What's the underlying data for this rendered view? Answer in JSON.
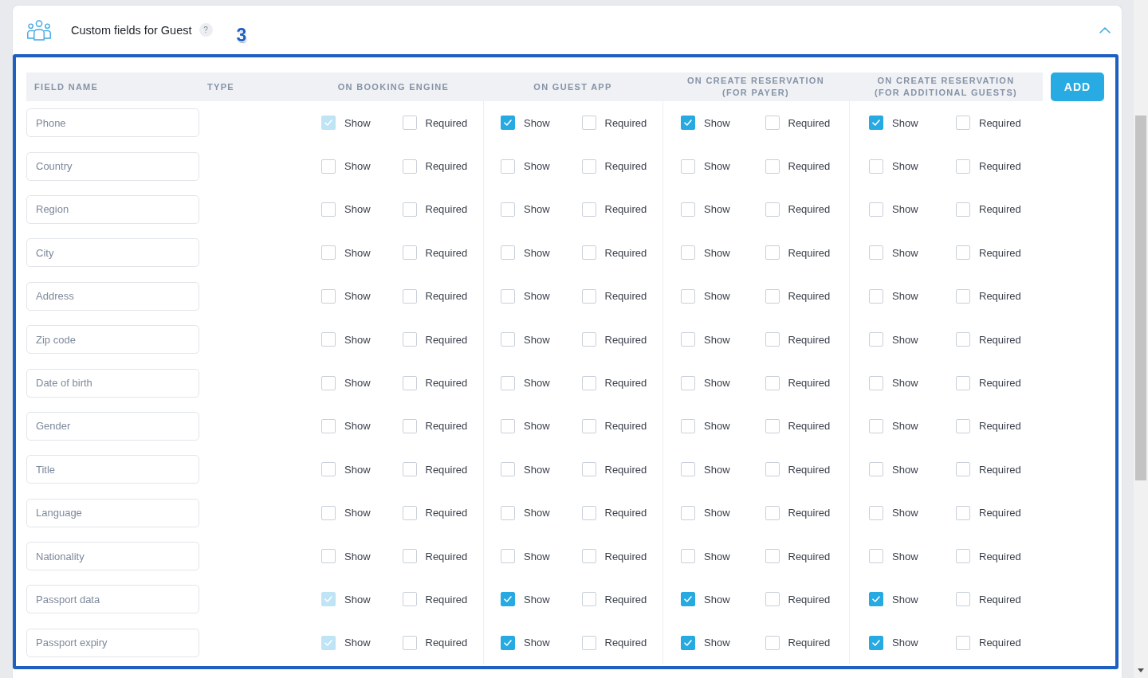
{
  "panel": {
    "title": "Custom fields for Guest",
    "help": "?",
    "annotation": "3",
    "expanded": true,
    "table": {
      "columns": [
        "FIELD NAME",
        "TYPE",
        "ON BOOKING ENGINE",
        "ON GUEST APP",
        "ON CREATE RESERVATION (FOR PAYER)",
        "ON CREATE RESERVATION (FOR ADDITIONAL GUESTS)"
      ],
      "add_button": "ADD",
      "rows": [
        {
          "field": "Phone",
          "groups": [
            {
              "show": {
                "label": "Show",
                "checked": true,
                "disabled": true
              },
              "required": {
                "label": "Required",
                "checked": false,
                "disabled": false
              }
            },
            {
              "show": {
                "label": "Show",
                "checked": true,
                "disabled": false
              },
              "required": {
                "label": "Required",
                "checked": false,
                "disabled": false
              }
            },
            {
              "show": {
                "label": "Show",
                "checked": true,
                "disabled": false
              },
              "required": {
                "label": "Required",
                "checked": false,
                "disabled": false
              }
            },
            {
              "show": {
                "label": "Show",
                "checked": true,
                "disabled": false
              },
              "required": {
                "label": "Required",
                "checked": false,
                "disabled": false
              }
            }
          ]
        },
        {
          "field": "Country",
          "groups": [
            {
              "show": {
                "label": "Show",
                "checked": false,
                "disabled": false
              },
              "required": {
                "label": "Required",
                "checked": false,
                "disabled": false
              }
            },
            {
              "show": {
                "label": "Show",
                "checked": false,
                "disabled": false
              },
              "required": {
                "label": "Required",
                "checked": false,
                "disabled": false
              }
            },
            {
              "show": {
                "label": "Show",
                "checked": false,
                "disabled": false
              },
              "required": {
                "label": "Required",
                "checked": false,
                "disabled": false
              }
            },
            {
              "show": {
                "label": "Show",
                "checked": false,
                "disabled": false
              },
              "required": {
                "label": "Required",
                "checked": false,
                "disabled": false
              }
            }
          ]
        },
        {
          "field": "Region",
          "groups": [
            {
              "show": {
                "label": "Show",
                "checked": false,
                "disabled": false
              },
              "required": {
                "label": "Required",
                "checked": false,
                "disabled": false
              }
            },
            {
              "show": {
                "label": "Show",
                "checked": false,
                "disabled": false
              },
              "required": {
                "label": "Required",
                "checked": false,
                "disabled": false
              }
            },
            {
              "show": {
                "label": "Show",
                "checked": false,
                "disabled": false
              },
              "required": {
                "label": "Required",
                "checked": false,
                "disabled": false
              }
            },
            {
              "show": {
                "label": "Show",
                "checked": false,
                "disabled": false
              },
              "required": {
                "label": "Required",
                "checked": false,
                "disabled": false
              }
            }
          ]
        },
        {
          "field": "City",
          "groups": [
            {
              "show": {
                "label": "Show",
                "checked": false,
                "disabled": false
              },
              "required": {
                "label": "Required",
                "checked": false,
                "disabled": false
              }
            },
            {
              "show": {
                "label": "Show",
                "checked": false,
                "disabled": false
              },
              "required": {
                "label": "Required",
                "checked": false,
                "disabled": false
              }
            },
            {
              "show": {
                "label": "Show",
                "checked": false,
                "disabled": false
              },
              "required": {
                "label": "Required",
                "checked": false,
                "disabled": false
              }
            },
            {
              "show": {
                "label": "Show",
                "checked": false,
                "disabled": false
              },
              "required": {
                "label": "Required",
                "checked": false,
                "disabled": false
              }
            }
          ]
        },
        {
          "field": "Address",
          "groups": [
            {
              "show": {
                "label": "Show",
                "checked": false,
                "disabled": false
              },
              "required": {
                "label": "Required",
                "checked": false,
                "disabled": false
              }
            },
            {
              "show": {
                "label": "Show",
                "checked": false,
                "disabled": false
              },
              "required": {
                "label": "Required",
                "checked": false,
                "disabled": false
              }
            },
            {
              "show": {
                "label": "Show",
                "checked": false,
                "disabled": false
              },
              "required": {
                "label": "Required",
                "checked": false,
                "disabled": false
              }
            },
            {
              "show": {
                "label": "Show",
                "checked": false,
                "disabled": false
              },
              "required": {
                "label": "Required",
                "checked": false,
                "disabled": false
              }
            }
          ]
        },
        {
          "field": "Zip code",
          "groups": [
            {
              "show": {
                "label": "Show",
                "checked": false,
                "disabled": false
              },
              "required": {
                "label": "Required",
                "checked": false,
                "disabled": false
              }
            },
            {
              "show": {
                "label": "Show",
                "checked": false,
                "disabled": false
              },
              "required": {
                "label": "Required",
                "checked": false,
                "disabled": false
              }
            },
            {
              "show": {
                "label": "Show",
                "checked": false,
                "disabled": false
              },
              "required": {
                "label": "Required",
                "checked": false,
                "disabled": false
              }
            },
            {
              "show": {
                "label": "Show",
                "checked": false,
                "disabled": false
              },
              "required": {
                "label": "Required",
                "checked": false,
                "disabled": false
              }
            }
          ]
        },
        {
          "field": "Date of birth",
          "groups": [
            {
              "show": {
                "label": "Show",
                "checked": false,
                "disabled": false
              },
              "required": {
                "label": "Required",
                "checked": false,
                "disabled": false
              }
            },
            {
              "show": {
                "label": "Show",
                "checked": false,
                "disabled": false
              },
              "required": {
                "label": "Required",
                "checked": false,
                "disabled": false
              }
            },
            {
              "show": {
                "label": "Show",
                "checked": false,
                "disabled": false
              },
              "required": {
                "label": "Required",
                "checked": false,
                "disabled": false
              }
            },
            {
              "show": {
                "label": "Show",
                "checked": false,
                "disabled": false
              },
              "required": {
                "label": "Required",
                "checked": false,
                "disabled": false
              }
            }
          ]
        },
        {
          "field": "Gender",
          "groups": [
            {
              "show": {
                "label": "Show",
                "checked": false,
                "disabled": false
              },
              "required": {
                "label": "Required",
                "checked": false,
                "disabled": false
              }
            },
            {
              "show": {
                "label": "Show",
                "checked": false,
                "disabled": false
              },
              "required": {
                "label": "Required",
                "checked": false,
                "disabled": false
              }
            },
            {
              "show": {
                "label": "Show",
                "checked": false,
                "disabled": false
              },
              "required": {
                "label": "Required",
                "checked": false,
                "disabled": false
              }
            },
            {
              "show": {
                "label": "Show",
                "checked": false,
                "disabled": false
              },
              "required": {
                "label": "Required",
                "checked": false,
                "disabled": false
              }
            }
          ]
        },
        {
          "field": "Title",
          "groups": [
            {
              "show": {
                "label": "Show",
                "checked": false,
                "disabled": false
              },
              "required": {
                "label": "Required",
                "checked": false,
                "disabled": false
              }
            },
            {
              "show": {
                "label": "Show",
                "checked": false,
                "disabled": false
              },
              "required": {
                "label": "Required",
                "checked": false,
                "disabled": false
              }
            },
            {
              "show": {
                "label": "Show",
                "checked": false,
                "disabled": false
              },
              "required": {
                "label": "Required",
                "checked": false,
                "disabled": false
              }
            },
            {
              "show": {
                "label": "Show",
                "checked": false,
                "disabled": false
              },
              "required": {
                "label": "Required",
                "checked": false,
                "disabled": false
              }
            }
          ]
        },
        {
          "field": "Language",
          "groups": [
            {
              "show": {
                "label": "Show",
                "checked": false,
                "disabled": false
              },
              "required": {
                "label": "Required",
                "checked": false,
                "disabled": false
              }
            },
            {
              "show": {
                "label": "Show",
                "checked": false,
                "disabled": false
              },
              "required": {
                "label": "Required",
                "checked": false,
                "disabled": false
              }
            },
            {
              "show": {
                "label": "Show",
                "checked": false,
                "disabled": false
              },
              "required": {
                "label": "Required",
                "checked": false,
                "disabled": false
              }
            },
            {
              "show": {
                "label": "Show",
                "checked": false,
                "disabled": false
              },
              "required": {
                "label": "Required",
                "checked": false,
                "disabled": false
              }
            }
          ]
        },
        {
          "field": "Nationality",
          "groups": [
            {
              "show": {
                "label": "Show",
                "checked": false,
                "disabled": false
              },
              "required": {
                "label": "Required",
                "checked": false,
                "disabled": false
              }
            },
            {
              "show": {
                "label": "Show",
                "checked": false,
                "disabled": false
              },
              "required": {
                "label": "Required",
                "checked": false,
                "disabled": false
              }
            },
            {
              "show": {
                "label": "Show",
                "checked": false,
                "disabled": false
              },
              "required": {
                "label": "Required",
                "checked": false,
                "disabled": false
              }
            },
            {
              "show": {
                "label": "Show",
                "checked": false,
                "disabled": false
              },
              "required": {
                "label": "Required",
                "checked": false,
                "disabled": false
              }
            }
          ]
        },
        {
          "field": "Passport data",
          "groups": [
            {
              "show": {
                "label": "Show",
                "checked": true,
                "disabled": true
              },
              "required": {
                "label": "Required",
                "checked": false,
                "disabled": false
              }
            },
            {
              "show": {
                "label": "Show",
                "checked": true,
                "disabled": false
              },
              "required": {
                "label": "Required",
                "checked": false,
                "disabled": false
              }
            },
            {
              "show": {
                "label": "Show",
                "checked": true,
                "disabled": false
              },
              "required": {
                "label": "Required",
                "checked": false,
                "disabled": false
              }
            },
            {
              "show": {
                "label": "Show",
                "checked": true,
                "disabled": false
              },
              "required": {
                "label": "Required",
                "checked": false,
                "disabled": false
              }
            }
          ]
        },
        {
          "field": "Passport expiry",
          "groups": [
            {
              "show": {
                "label": "Show",
                "checked": true,
                "disabled": true
              },
              "required": {
                "label": "Required",
                "checked": false,
                "disabled": false
              }
            },
            {
              "show": {
                "label": "Show",
                "checked": true,
                "disabled": false
              },
              "required": {
                "label": "Required",
                "checked": false,
                "disabled": false
              }
            },
            {
              "show": {
                "label": "Show",
                "checked": true,
                "disabled": false
              },
              "required": {
                "label": "Required",
                "checked": false,
                "disabled": false
              }
            },
            {
              "show": {
                "label": "Show",
                "checked": true,
                "disabled": false
              },
              "required": {
                "label": "Required",
                "checked": false,
                "disabled": false
              }
            }
          ]
        }
      ]
    }
  }
}
